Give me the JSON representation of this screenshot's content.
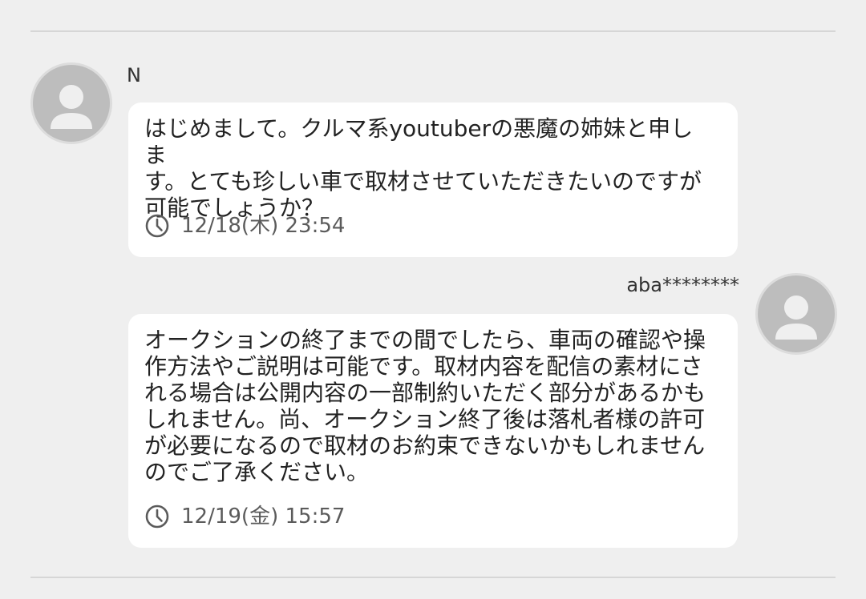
{
  "messages": [
    {
      "sender": "N",
      "text": "はじめまして。クルマ系youtuberの悪魔の姉妹と申しま\nす。とても珍しい車で取材させていただきたいのですが\n可能でしょうか？",
      "timestamp": "12/18(木) 23:54",
      "avatar_icon": "default-user-avatar",
      "side": "left"
    },
    {
      "sender": "aba********",
      "text": "オークションの終了までの間でしたら、車両の確認や操\n作方法やご説明は可能です。取材内容を配信の素材にさ\nれる場合は公開内容の一部制約いただく部分があるかも\nしれません。尚、オークション終了後は落札者様の許可\nが必要になるので取材のお約束できないかもしれません\nのでご了承ください。",
      "timestamp": "12/19(金) 15:57",
      "avatar_icon": "default-user-avatar",
      "side": "right"
    }
  ],
  "icons": {
    "timestamp": "clock-icon"
  },
  "colors": {
    "background": "#efefef",
    "bubble": "#ffffff",
    "avatar": "#bdbdbd",
    "divider": "#d6d6d6",
    "timestamp_text": "#5b5b5b"
  }
}
